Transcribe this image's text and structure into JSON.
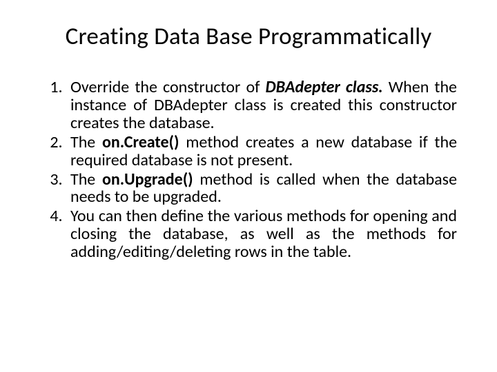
{
  "title": "Creating Data Base Programmatically",
  "items": [
    {
      "p1": "Override the constructor of ",
      "em": "DBAdepter class.",
      "p2": " When the instance of DBAdepter class is created this constructor creates the database."
    },
    {
      "p1": "The ",
      "b": "on.Create()",
      "p2": " method creates a new database if the required database is not present."
    },
    {
      "p1": "The ",
      "b": "on.Upgrade()",
      "p2": " method is called when the database needs to be upgraded."
    },
    {
      "p1": "You can then define the various methods for opening and closing the database, as well as the methods for adding/editing/deleting rows in the table."
    }
  ]
}
